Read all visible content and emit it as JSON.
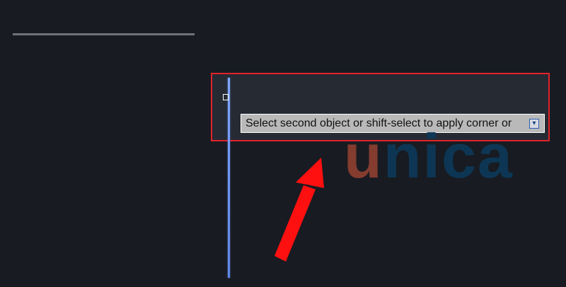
{
  "tooltip": {
    "text": "Select second object or shift-select to apply corner or"
  },
  "watermark": {
    "first": "u",
    "rest": "nica"
  },
  "icons": {
    "expand": "expand-icon",
    "cursor": "cursor-square-icon",
    "arrow": "pointer-arrow-icon"
  },
  "colors": {
    "background": "#181b21",
    "highlight_border": "#e1232b",
    "selected_line": "#7fa7ff",
    "tooltip_bg": "#b9b9b9"
  }
}
